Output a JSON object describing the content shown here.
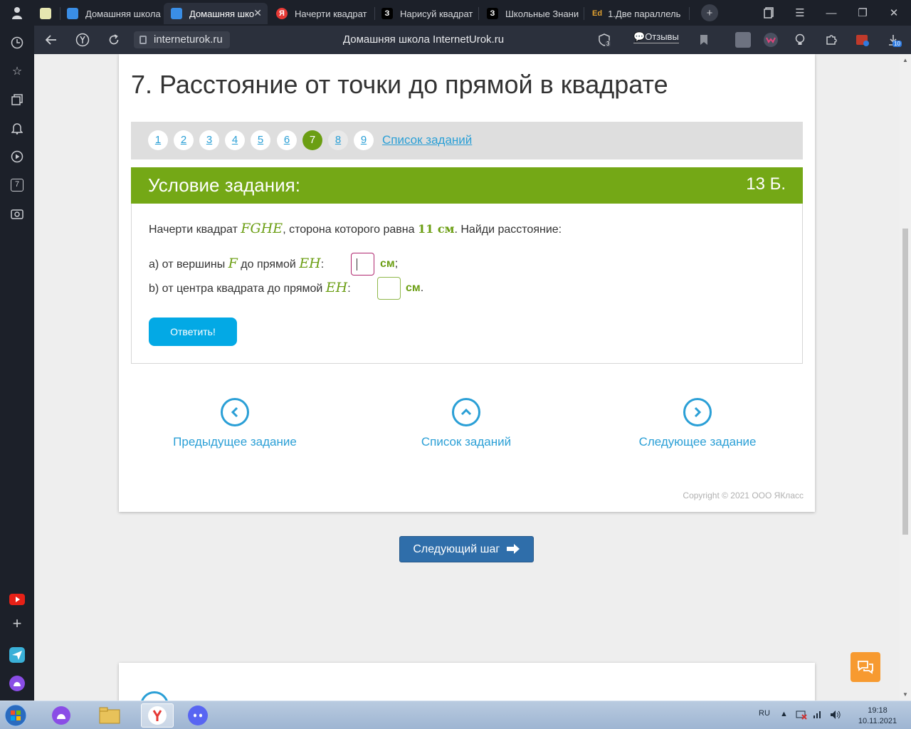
{
  "browser": {
    "tabs": [
      {
        "label": "",
        "fav_color": "#6b9e13"
      },
      {
        "label": "Домашняя школа",
        "fav_color": "#3a8ee6"
      },
      {
        "label": "Домашняя шко",
        "fav_color": "#3a8ee6",
        "active": true
      },
      {
        "label": "Начерти квадрат",
        "fav_color": "#e53935",
        "fav_char": "Я"
      },
      {
        "label": "Нарисуй квадрат",
        "fav_color": "#000000",
        "fav_char": "З"
      },
      {
        "label": "Школьные Знани",
        "fav_color": "#000000",
        "fav_char": "З"
      },
      {
        "label": "1.Две параллель",
        "fav_color": "#e0a030",
        "fav_char": "Ed"
      }
    ],
    "url": "interneturok.ru",
    "page_title": "Домашняя школа InternetUrok.ru",
    "reviews_label": "Отзывы",
    "ext_badge": "3",
    "downloads_badge": "10",
    "sidebar_count": "7"
  },
  "page": {
    "title": "7. Расстояние от точки до прямой в квадрате",
    "pager": [
      "1",
      "2",
      "3",
      "4",
      "5",
      "6",
      "7",
      "8",
      "9"
    ],
    "pager_current": "7",
    "tasks_link": "Список заданий",
    "condition_title": "Условие задания:",
    "points": "13 Б.",
    "statement_prefix": "Начерти квадрат ",
    "square_name": "FGHE",
    "statement_mid": ", сторона которого равна ",
    "side_value": "11 см",
    "statement_suffix": ". Найди расстояние:",
    "q_a_prefix": "a) от вершины ",
    "q_a_point": "F",
    "q_a_mid": " до прямой ",
    "q_a_line": "EH",
    "q_colon": ":",
    "unit": "см",
    "q_a_end": ";",
    "q_b_prefix": "b) от центра квадрата до прямой ",
    "q_b_line": "EH",
    "q_b_end": ".",
    "answer_a": "",
    "answer_b": "",
    "answer_button": "Ответить!",
    "prev_label": "Предыдущее задание",
    "list_label": "Список заданий",
    "next_label": "Следующее задание",
    "copyright": "Copyright © 2021 ООО ЯКласс",
    "next_step": "Следующий шаг"
  },
  "taskbar": {
    "lang": "RU",
    "time": "19:18",
    "date": "10.11.2021"
  },
  "colors": {
    "accent_green": "#74a816",
    "link_blue": "#2a9fd6",
    "button_blue": "#03a9e5"
  }
}
